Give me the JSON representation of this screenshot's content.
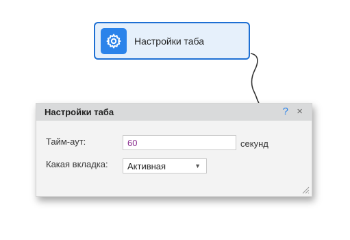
{
  "node": {
    "label": "Настройки таба",
    "icon": "gear-icon"
  },
  "dialog": {
    "title": "Настройки таба",
    "help_label": "?",
    "close_label": "×",
    "timeout_label": "Тайм-аут:",
    "timeout_value": "60",
    "timeout_unit": "секунд",
    "tab_label": "Какая вкладка:",
    "tab_value": "Активная"
  },
  "colors": {
    "accent": "#2b83ea",
    "node_border": "#1d6fd3",
    "value_text": "#8a2d8f"
  }
}
